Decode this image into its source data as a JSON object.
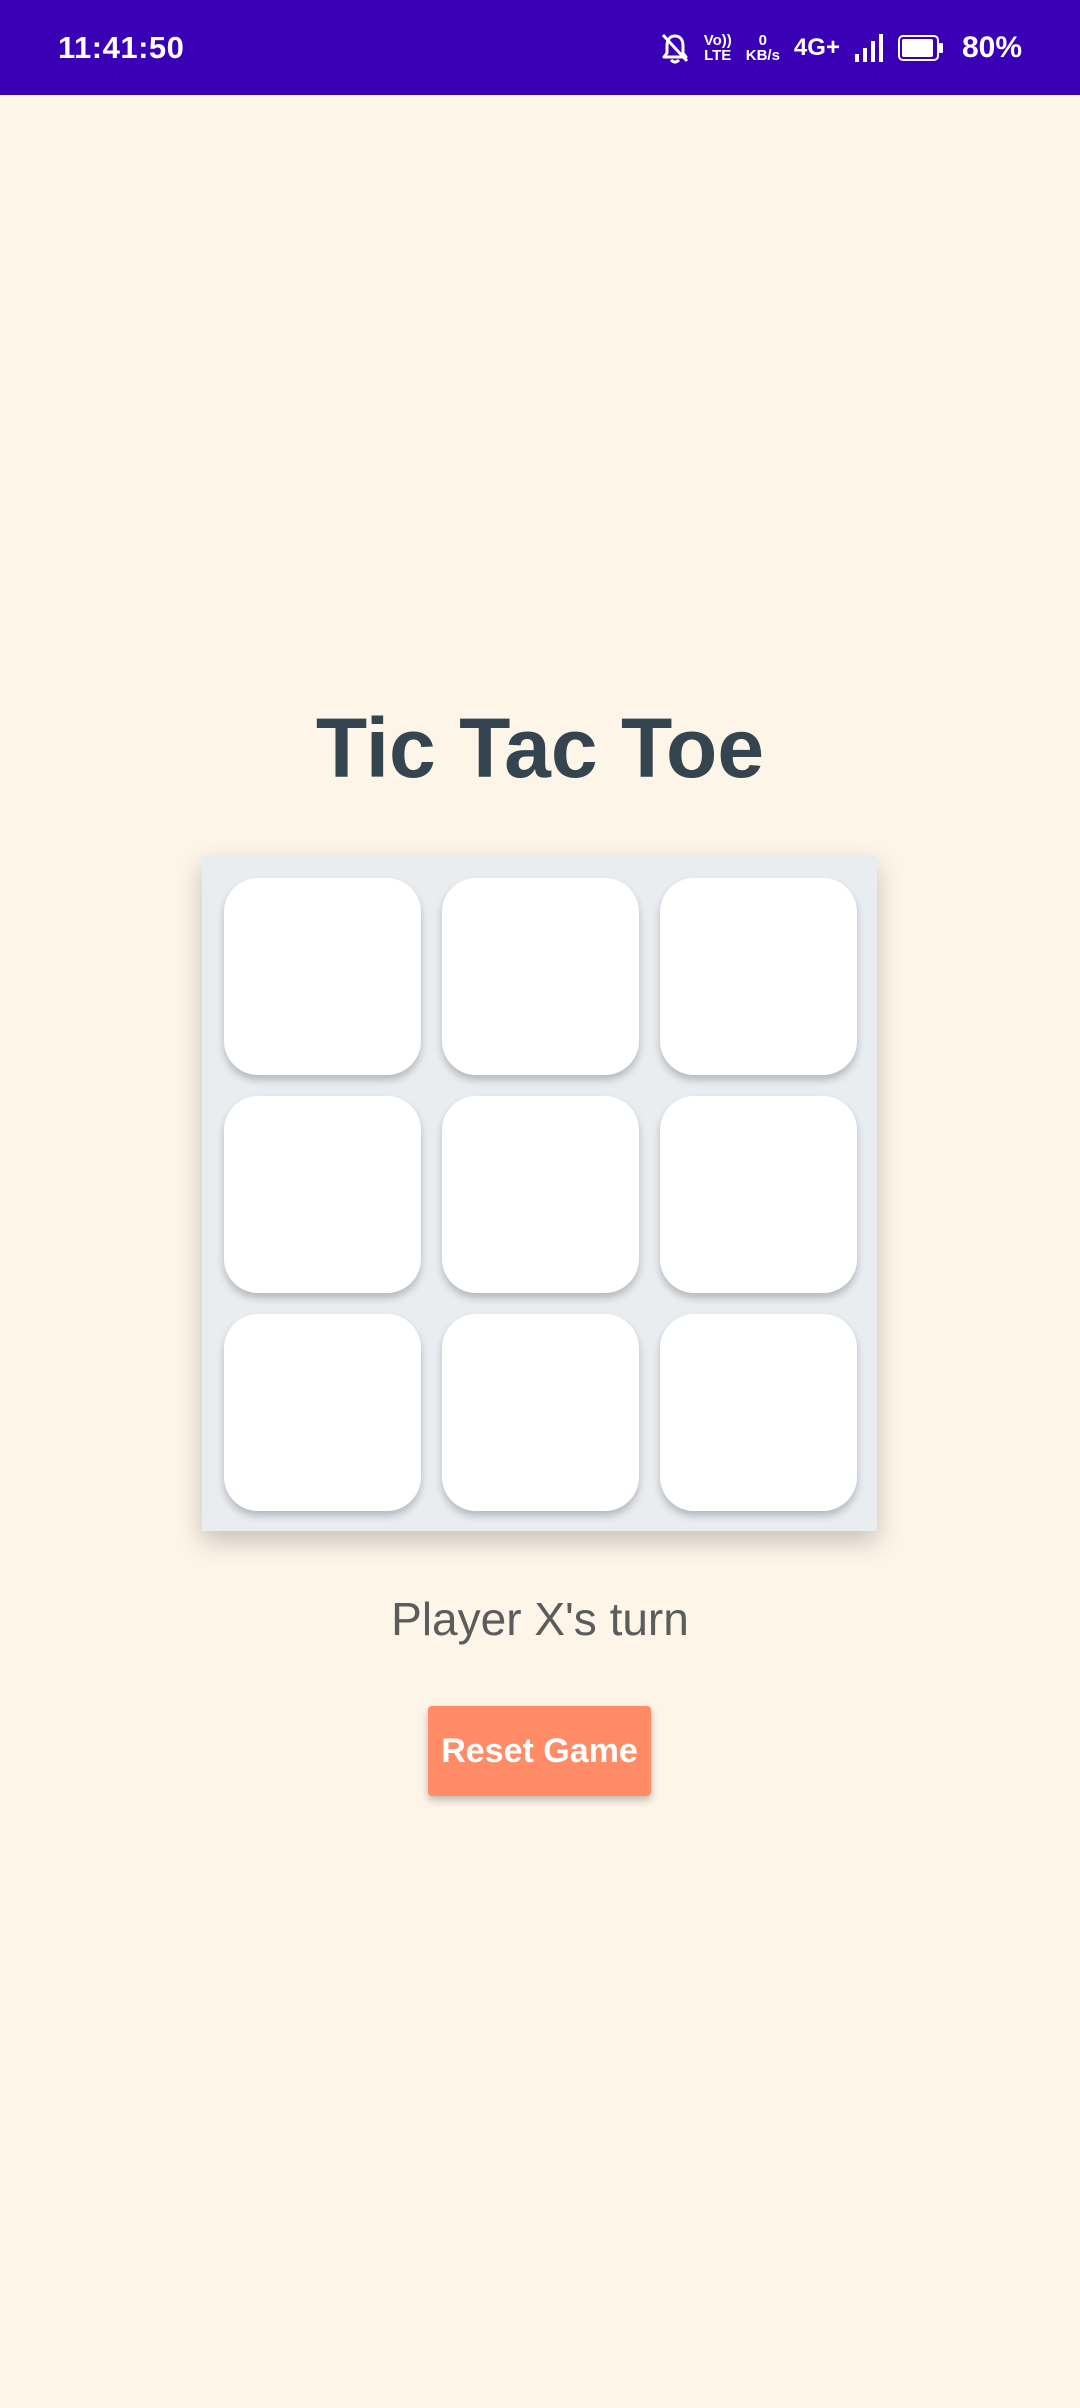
{
  "status_bar": {
    "time": "11:41:50",
    "volte_top": "Vo))",
    "volte_bottom": "LTE",
    "speed_value": "0",
    "speed_unit": "KB/s",
    "network": "4G+",
    "battery": "80%",
    "icons": [
      "bell-off-icon",
      "volte-icon",
      "network-speed",
      "signal-icon",
      "battery-icon"
    ]
  },
  "game": {
    "title": "Tic Tac Toe",
    "cells": [
      "",
      "",
      "",
      "",
      "",
      "",
      "",
      "",
      ""
    ],
    "status": "Player X's turn",
    "reset_label": "Reset Game"
  },
  "colors": {
    "status_bar": "#3a00b6",
    "background": "#fdf5e8",
    "title": "#34454f",
    "board": "#e9edf0",
    "cell": "#ffffff",
    "reset_button": "#ff8c66"
  }
}
